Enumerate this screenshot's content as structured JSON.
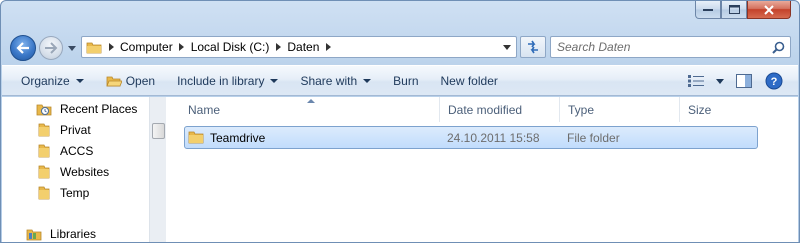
{
  "window": {
    "caption_buttons": [
      {
        "name": "minimize",
        "icon": "minimize-icon"
      },
      {
        "name": "maximize",
        "icon": "maximize-icon"
      },
      {
        "name": "close",
        "icon": "close-icon"
      }
    ]
  },
  "navigation": {
    "breadcrumbs": [
      "Computer",
      "Local Disk (C:)",
      "Daten"
    ],
    "search_placeholder": "Search Daten"
  },
  "commandbar": {
    "organize": "Organize",
    "open": "Open",
    "include_in_library": "Include in library",
    "share_with": "Share with",
    "burn": "Burn",
    "new_folder": "New folder"
  },
  "nav_pane": {
    "items": [
      {
        "label": "Recent Places",
        "icon": "recent-places-icon"
      },
      {
        "label": "Privat",
        "icon": "folder-icon"
      },
      {
        "label": "ACCS",
        "icon": "folder-icon"
      },
      {
        "label": "Websites",
        "icon": "folder-icon"
      },
      {
        "label": "Temp",
        "icon": "folder-icon"
      }
    ],
    "libraries": {
      "label": "Libraries",
      "icon": "libraries-icon"
    }
  },
  "file_list": {
    "columns": [
      "Name",
      "Date modified",
      "Type",
      "Size"
    ],
    "rows": [
      {
        "name": "Teamdrive",
        "date_modified": "24.10.2011 15:58",
        "type": "File folder",
        "size": "",
        "selected": true
      }
    ]
  },
  "colors": {
    "accent": "#1e395b",
    "selection": "#c1dcfc",
    "folder": "#e8b84a"
  }
}
